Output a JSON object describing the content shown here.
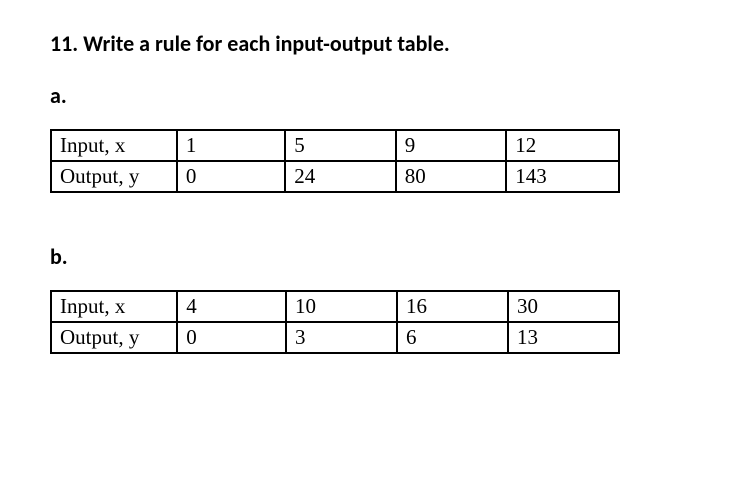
{
  "question": {
    "number": "11.",
    "prompt": "Write a rule for each input-output table."
  },
  "parts": {
    "a": {
      "label": "a.",
      "input_label": "Input, x",
      "output_label": "Output, y",
      "inputs": [
        "1",
        "5",
        "9",
        "12"
      ],
      "outputs": [
        "0",
        "24",
        "80",
        "143"
      ]
    },
    "b": {
      "label": "b.",
      "input_label": "Input, x",
      "output_label": "Output, y",
      "inputs": [
        "4",
        "10",
        "16",
        "30"
      ],
      "outputs": [
        "0",
        "3",
        "6",
        "13"
      ]
    }
  },
  "chart_data": [
    {
      "type": "table",
      "title": "Part a",
      "rows": [
        {
          "label": "Input, x",
          "values": [
            1,
            5,
            9,
            12
          ]
        },
        {
          "label": "Output, y",
          "values": [
            0,
            24,
            80,
            143
          ]
        }
      ]
    },
    {
      "type": "table",
      "title": "Part b",
      "rows": [
        {
          "label": "Input, x",
          "values": [
            4,
            10,
            16,
            30
          ]
        },
        {
          "label": "Output, y",
          "values": [
            0,
            3,
            6,
            13
          ]
        }
      ]
    }
  ]
}
